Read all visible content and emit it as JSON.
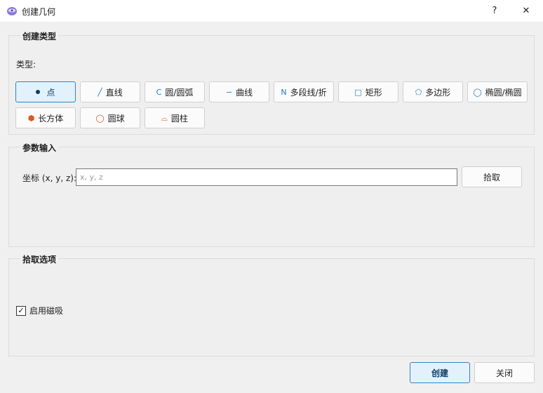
{
  "window": {
    "title": "创建几何",
    "help": "?",
    "close": "✕"
  },
  "group_types": {
    "title": "创建类型",
    "type_label": "类型:",
    "buttons": [
      {
        "icon": "●",
        "label": "点"
      },
      {
        "icon": "╱",
        "label": "直线"
      },
      {
        "icon": "C",
        "label": "圆/圆弧"
      },
      {
        "icon": "∽",
        "label": "曲线"
      },
      {
        "icon": "N",
        "label": "多段线/折"
      },
      {
        "icon": "□",
        "label": "矩形"
      },
      {
        "icon": "⬠",
        "label": "多边形"
      },
      {
        "icon": "◯",
        "label": "椭圆/椭圆"
      },
      {
        "icon": "⬢",
        "label": "长方体"
      },
      {
        "icon": "◯",
        "label": "圆球"
      },
      {
        "icon": "⌓",
        "label": "圆柱"
      }
    ]
  },
  "group_params": {
    "title": "参数输入",
    "coord_label": "坐标 (x, y, z):",
    "coord_placeholder": "x, y, z",
    "pick_label": "拾取"
  },
  "group_pick": {
    "title": "拾取选项",
    "snap_label": "启用磁吸",
    "snap_checked": true
  },
  "footer": {
    "create_label": "创建",
    "cancel_label": "关闭"
  },
  "colors": {
    "accent": "#2a86c8",
    "accent_bg": "#e3f1fb",
    "icon_blue": "#1e7bc4",
    "icon_orange": "#e0561b"
  }
}
